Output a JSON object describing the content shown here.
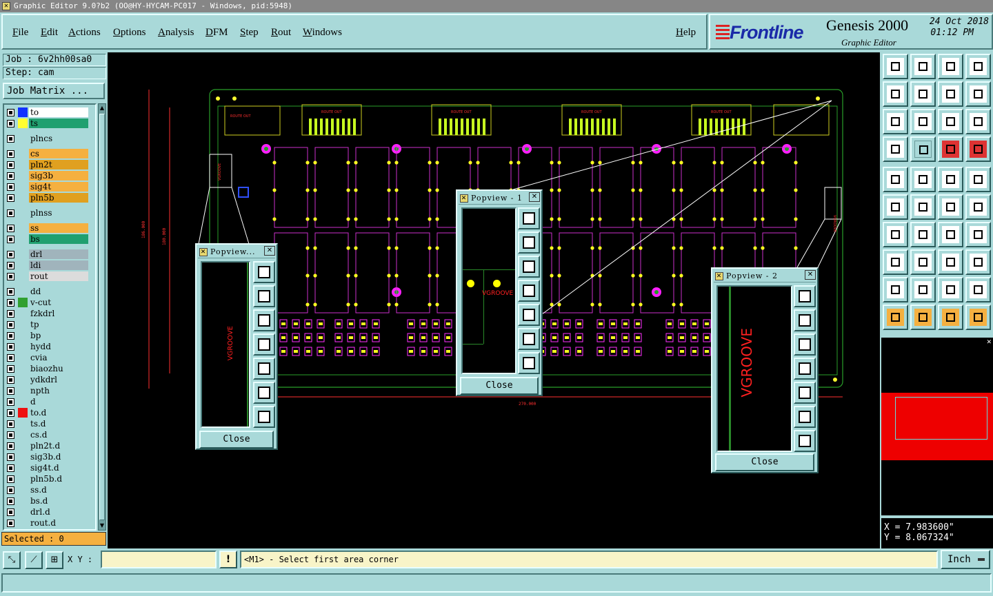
{
  "window": {
    "title": "Graphic Editor 9.0?b2 (OO@HY-HYCAM-PC017 - Windows, pid:5948)"
  },
  "menu": {
    "items": [
      "File",
      "Edit",
      "Actions",
      "Options",
      "Analysis",
      "DFM",
      "Step",
      "Rout",
      "Windows"
    ],
    "help": "Help"
  },
  "branding": {
    "company": "Frontline",
    "product": "Genesis 2000",
    "subtitle": "Graphic Editor",
    "date": "24 Oct 2018",
    "time": "01:12 PM"
  },
  "job": {
    "job_label": "Job : 6v2hh00sa0",
    "step_label": "Step: cam",
    "matrix_button": "Job Matrix ..."
  },
  "layers": [
    {
      "name": "to",
      "swatch": "#1030ff",
      "bg": "#ffffff",
      "mark": ""
    },
    {
      "name": "ts",
      "swatch": "#ffff30",
      "bg": "#20a070",
      "mark": ""
    },
    {
      "name": "plncs",
      "swatch": "",
      "bg": "#a9d9d9",
      "mark": ""
    },
    {
      "name": "cs",
      "swatch": "",
      "bg": "#f5b040",
      "mark": ""
    },
    {
      "name": "pln2t",
      "swatch": "",
      "bg": "#e0a020",
      "mark": "✎"
    },
    {
      "name": "sig3b",
      "swatch": "",
      "bg": "#f5b040",
      "mark": ""
    },
    {
      "name": "sig4t",
      "swatch": "",
      "bg": "#f5b040",
      "mark": ""
    },
    {
      "name": "pln5b",
      "swatch": "",
      "bg": "#e0a020",
      "mark": "✎"
    },
    {
      "name": "plnss",
      "swatch": "",
      "bg": "#a9d9d9",
      "mark": ""
    },
    {
      "name": "ss",
      "swatch": "",
      "bg": "#f5b040",
      "mark": ""
    },
    {
      "name": "bs",
      "swatch": "",
      "bg": "#20a070",
      "mark": ""
    },
    {
      "name": "drl",
      "swatch": "",
      "bg": "#a0b4bc",
      "mark": ""
    },
    {
      "name": "ldi",
      "swatch": "",
      "bg": "#a0b4bc",
      "mark": ""
    },
    {
      "name": "rout",
      "swatch": "",
      "bg": "#dcdcdc",
      "mark": ""
    },
    {
      "name": "dd",
      "swatch": "",
      "bg": "#a9d9d9",
      "mark": ""
    },
    {
      "name": "v-cut",
      "swatch": "#30a030",
      "bg": "#a9d9d9",
      "mark": ""
    },
    {
      "name": "fzkdrl",
      "swatch": "",
      "bg": "#a9d9d9",
      "mark": ""
    },
    {
      "name": "tp",
      "swatch": "",
      "bg": "#a9d9d9",
      "mark": ""
    },
    {
      "name": "bp",
      "swatch": "",
      "bg": "#a9d9d9",
      "mark": ""
    },
    {
      "name": "hydd",
      "swatch": "",
      "bg": "#a9d9d9",
      "mark": ""
    },
    {
      "name": "cvia",
      "swatch": "",
      "bg": "#a9d9d9",
      "mark": ""
    },
    {
      "name": "biaozhu",
      "swatch": "",
      "bg": "#a9d9d9",
      "mark": ""
    },
    {
      "name": "ydkdrl",
      "swatch": "",
      "bg": "#a9d9d9",
      "mark": ""
    },
    {
      "name": "npth",
      "swatch": "",
      "bg": "#a9d9d9",
      "mark": ""
    },
    {
      "name": "d",
      "swatch": "",
      "bg": "#a9d9d9",
      "mark": ""
    },
    {
      "name": "to.d",
      "swatch": "#ee1010",
      "bg": "#a9d9d9",
      "mark": "⊞"
    },
    {
      "name": "ts.d",
      "swatch": "",
      "bg": "#a9d9d9",
      "mark": ""
    },
    {
      "name": "cs.d",
      "swatch": "",
      "bg": "#a9d9d9",
      "mark": ""
    },
    {
      "name": "pln2t.d",
      "swatch": "",
      "bg": "#a9d9d9",
      "mark": "✎"
    },
    {
      "name": "sig3b.d",
      "swatch": "",
      "bg": "#a9d9d9",
      "mark": ""
    },
    {
      "name": "sig4t.d",
      "swatch": "",
      "bg": "#a9d9d9",
      "mark": ""
    },
    {
      "name": "pln5b.d",
      "swatch": "",
      "bg": "#a9d9d9",
      "mark": "✎"
    },
    {
      "name": "ss.d",
      "swatch": "",
      "bg": "#a9d9d9",
      "mark": ""
    },
    {
      "name": "bs.d",
      "swatch": "",
      "bg": "#a9d9d9",
      "mark": ""
    },
    {
      "name": "drl.d",
      "swatch": "",
      "bg": "#a9d9d9",
      "mark": ""
    },
    {
      "name": "rout.d",
      "swatch": "",
      "bg": "#a9d9d9",
      "mark": ""
    }
  ],
  "selected": "Selected : 0",
  "canvas": {
    "route_out": "ROUTE OUT",
    "dimension_bottom": "270.000",
    "dimension_left_1": "186.000",
    "dimension_left_2": "180.000",
    "vgroove_label": "VGROOVE"
  },
  "popups": [
    {
      "title": "Popview...",
      "close": "Close",
      "label": "VGROOVE"
    },
    {
      "title": "Popview - 1",
      "close": "Close",
      "label": "VGROOVE"
    },
    {
      "title": "Popview - 2",
      "close": "Close",
      "label": "VGROOVE"
    }
  ],
  "coords": {
    "x": "X = 7.983600\"",
    "y": "Y = 8.067324\""
  },
  "bottom": {
    "xy_label": "X Y :",
    "xy_value": "",
    "prompt": "<M1> - Select first area corner",
    "units": "Inch"
  },
  "tool_icons": [
    "clip-top-icon",
    "clip-bottom-icon",
    "home-icon",
    "split-view-icon",
    "clip-left-icon",
    "clip-right-icon",
    "pan-icon",
    "rotate-icon",
    "zoom-fit-icon",
    "center-icon",
    "scale-1-2-icon",
    "help-icon",
    "measure-icon",
    "grid-icon",
    "snap-icon",
    "layers-icon",
    "select-icon",
    "draw-line-icon",
    "ruler-icon",
    "pad-icon",
    "connect-icon",
    "cross-icon",
    "move-icon",
    "point-icon",
    "angle-icon",
    "line-icon",
    "arc-icon",
    "text-icon",
    "add-pad-icon",
    "cut-icon",
    "bracket-icon",
    "net-icon",
    "triangle-icon",
    "triangle-alt-icon",
    "arch-icon",
    "arch-cross-icon",
    "pointer-icon",
    "pointer-box-icon",
    "pointer-select-icon",
    "pointer-path-icon"
  ]
}
